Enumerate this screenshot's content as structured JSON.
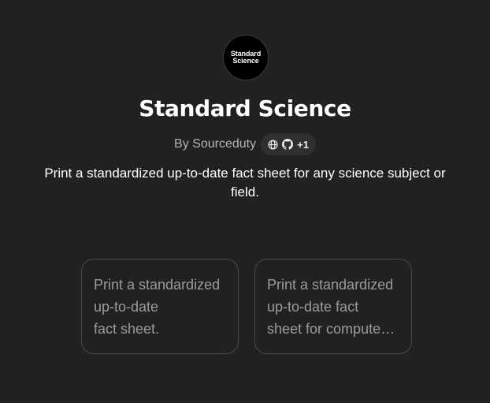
{
  "gpt": {
    "logo_line1": "Standard",
    "logo_line2": "Science",
    "name": "Standard Science",
    "author": "By Sourceduty",
    "links": {
      "icons": [
        "globe-icon",
        "github-icon"
      ],
      "extra_count": "+1"
    },
    "description": "Print a standardized up-to-date fact sheet for any science subject or field."
  },
  "conversation_starters": [
    {
      "lines": [
        "Print a standardized",
        "up-to-date",
        "fact sheet."
      ]
    },
    {
      "lines": [
        "Print a standardized",
        "up-to-date fact",
        "sheet for compute…"
      ]
    }
  ],
  "colors": {
    "background": "#212121",
    "card_border": "#4a4a4a",
    "pill_background": "#2f2f2f",
    "muted_text": "#b4b4b4"
  }
}
